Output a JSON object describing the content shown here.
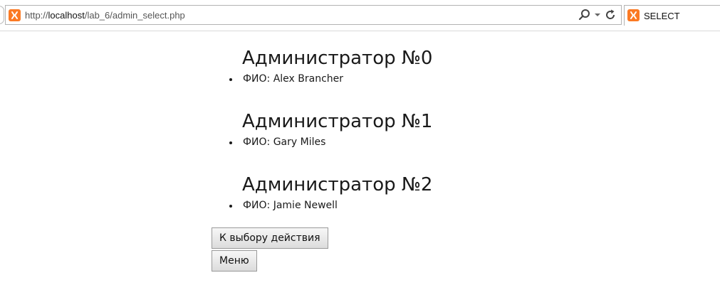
{
  "browser": {
    "url_prefix": "http://",
    "url_host": "localhost",
    "url_path": "/lab_6/admin_select.php",
    "tab_title": "SELECT",
    "icons": [
      "xampp-logo-icon",
      "search-icon",
      "dropdown-arrow-icon",
      "refresh-icon"
    ],
    "accent_color": "#fb7a24"
  },
  "admins": [
    {
      "heading": "Администратор №0",
      "fio": "ФИО: Alex Brancher"
    },
    {
      "heading": "Администратор №1",
      "fio": "ФИО: Gary Miles"
    },
    {
      "heading": "Администратор №2",
      "fio": "ФИО: Jamie Newell"
    }
  ],
  "buttons": {
    "choose_action": "К выбору действия",
    "menu": "Меню"
  }
}
